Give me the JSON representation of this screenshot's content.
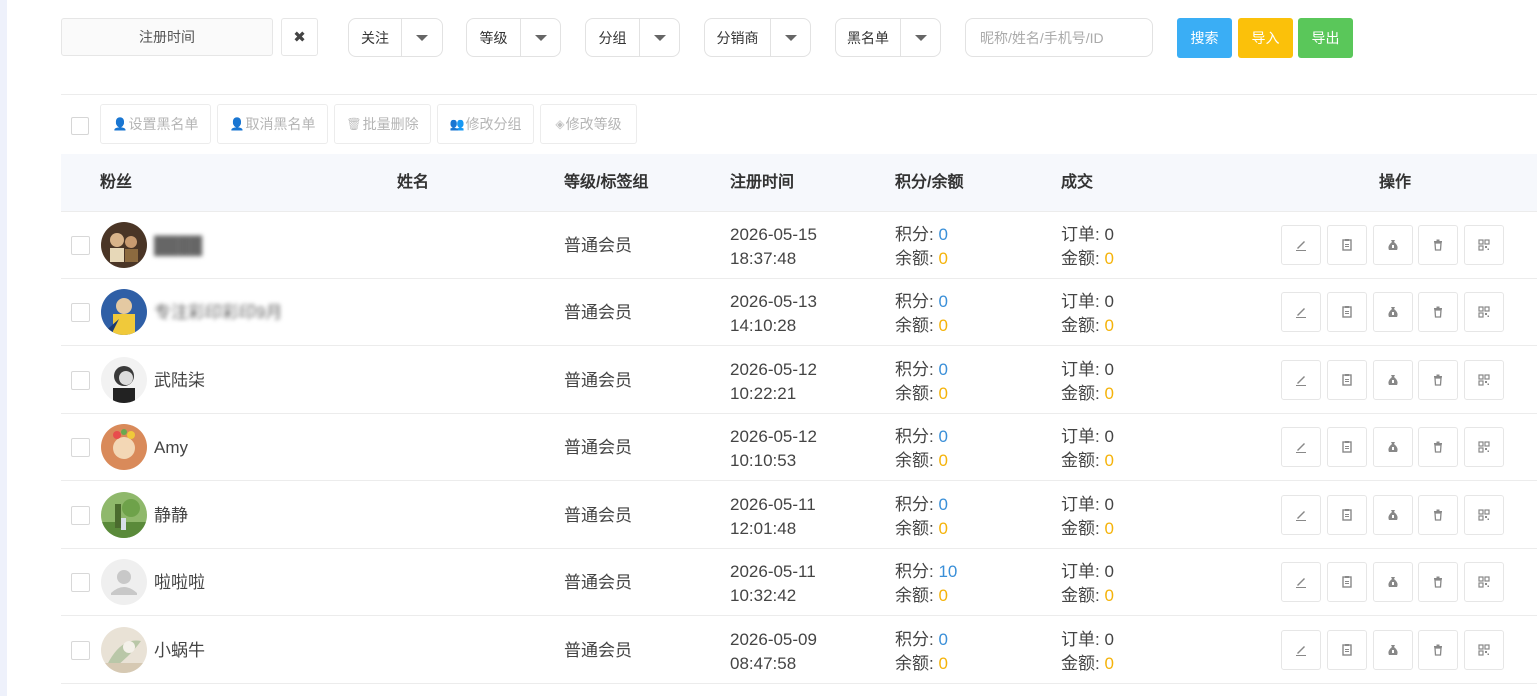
{
  "filters": {
    "date_placeholder": "注册时间",
    "clear_icon": "close-icon",
    "follow_label": "关注",
    "level_label": "等级",
    "group_label": "分组",
    "distributor_label": "分销商",
    "blacklist_label": "黑名单",
    "search_placeholder": "昵称/姓名/手机号/ID",
    "search_button": "搜索",
    "import_button": "导入",
    "export_button": "导出"
  },
  "colors": {
    "search_button": "#3aaef5",
    "import_button": "#fbc10a",
    "export_button": "#5ac75a",
    "points_value": "#3a8fd8",
    "balance_value": "#f5b30a"
  },
  "bulk_actions": {
    "set_blacklist": "设置黑名单",
    "cancel_blacklist": "取消黑名单",
    "batch_delete": "批量删除",
    "modify_group": "修改分组",
    "modify_level": "修改等级"
  },
  "table": {
    "headers": {
      "fans": "粉丝",
      "name": "姓名",
      "level_tag": "等级/标签组",
      "reg_time": "注册时间",
      "points_balance": "积分/余额",
      "deal": "成交",
      "actions": "操作"
    },
    "labels": {
      "points": "积分: ",
      "balance": "余额: ",
      "orders": "订单: ",
      "amount": "金额: "
    },
    "action_icons": [
      "edit-icon",
      "detail-icon",
      "money-bag-icon",
      "trash-icon",
      "qrcode-icon"
    ],
    "rows": [
      {
        "nickname": "████",
        "level": "普通会员",
        "date": "2026-05-15",
        "time": "18:37:48",
        "points": "0",
        "balance": "0",
        "orders": "0",
        "amount": "0"
      },
      {
        "nickname": "专注彩印彩印9月",
        "level": "普通会员",
        "date": "2026-05-13",
        "time": "14:10:28",
        "points": "0",
        "balance": "0",
        "orders": "0",
        "amount": "0"
      },
      {
        "nickname": "武陆柒",
        "level": "普通会员",
        "date": "2026-05-12",
        "time": "10:22:21",
        "points": "0",
        "balance": "0",
        "orders": "0",
        "amount": "0"
      },
      {
        "nickname": "Amy",
        "level": "普通会员",
        "date": "2026-05-12",
        "time": "10:10:53",
        "points": "0",
        "balance": "0",
        "orders": "0",
        "amount": "0"
      },
      {
        "nickname": "静静",
        "level": "普通会员",
        "date": "2026-05-11",
        "time": "12:01:48",
        "points": "0",
        "balance": "0",
        "orders": "0",
        "amount": "0"
      },
      {
        "nickname": "啦啦啦",
        "level": "普通会员",
        "date": "2026-05-11",
        "time": "10:32:42",
        "points": "10",
        "balance": "0",
        "orders": "0",
        "amount": "0"
      },
      {
        "nickname": "小蜗牛",
        "level": "普通会员",
        "date": "2026-05-09",
        "time": "08:47:58",
        "points": "0",
        "balance": "0",
        "orders": "0",
        "amount": "0"
      }
    ]
  }
}
